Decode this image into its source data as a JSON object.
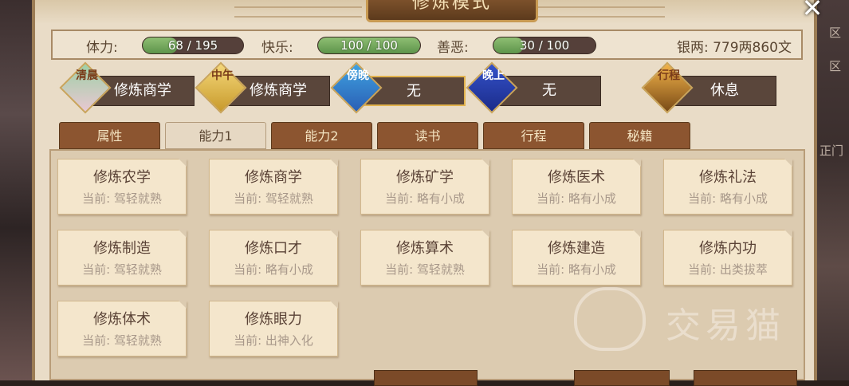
{
  "title": "修炼模式",
  "stats": {
    "stamina": {
      "label": "体力:",
      "text": "68 / 195",
      "fraction": 0.349
    },
    "happiness": {
      "label": "快乐:",
      "text": "100 / 100",
      "fraction": 1.0
    },
    "morality": {
      "label": "善恶:",
      "text": "30 / 100",
      "fraction": 0.3
    },
    "money": "银两: 779两860文"
  },
  "schedule": [
    {
      "badge": "清晨",
      "value": "修炼商学",
      "active": false
    },
    {
      "badge": "中午",
      "value": "修炼商学",
      "active": false
    },
    {
      "badge": "傍晚",
      "value": "无",
      "active": true
    },
    {
      "badge": "晚上",
      "value": "无",
      "active": false
    },
    {
      "badge": "行程",
      "value": "休息",
      "active": false
    }
  ],
  "tabs": [
    "属性",
    "能力1",
    "能力2",
    "读书",
    "行程",
    "秘籍"
  ],
  "active_tab": "能力1",
  "cards": [
    {
      "title": "修炼农学",
      "status": "当前: 驾轻就熟"
    },
    {
      "title": "修炼商学",
      "status": "当前: 驾轻就熟"
    },
    {
      "title": "修炼矿学",
      "status": "当前: 略有小成"
    },
    {
      "title": "修炼医术",
      "status": "当前: 略有小成"
    },
    {
      "title": "修炼礼法",
      "status": "当前: 略有小成"
    },
    {
      "title": "修炼制造",
      "status": "当前: 驾轻就熟"
    },
    {
      "title": "修炼口才",
      "status": "当前: 略有小成"
    },
    {
      "title": "修炼算术",
      "status": "当前: 驾轻就熟"
    },
    {
      "title": "修炼建造",
      "status": "当前: 略有小成"
    },
    {
      "title": "修炼内功",
      "status": "当前: 出类拔萃"
    },
    {
      "title": "修炼体术",
      "status": "当前: 驾轻就熟"
    },
    {
      "title": "修炼眼力",
      "status": "当前: 出神入化"
    }
  ],
  "side_text": {
    "right": [
      "区",
      "区",
      "正门"
    ]
  },
  "watermark": "交易猫",
  "colors": {
    "bar_green": "#5d944a",
    "tab_brown": "#8c5530",
    "active_slot_border": "#e2b34e"
  }
}
